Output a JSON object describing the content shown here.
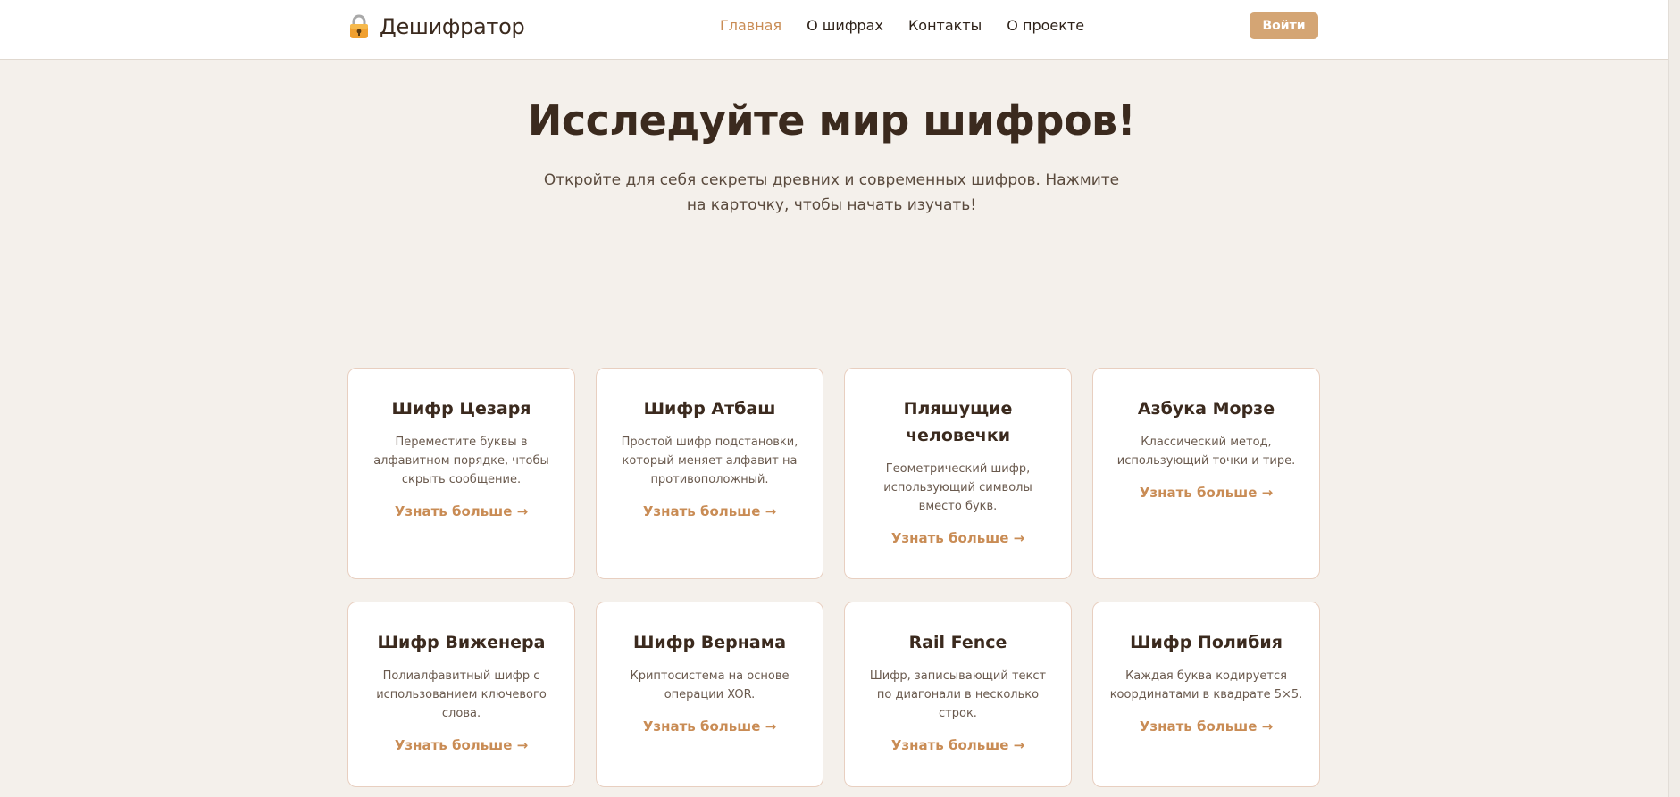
{
  "header": {
    "logo_text": "Дешифратор",
    "logo_icon": "padlock-icon",
    "nav": [
      {
        "label": "Главная",
        "active": true
      },
      {
        "label": "О шифрах",
        "active": false
      },
      {
        "label": "Контакты",
        "active": false
      },
      {
        "label": "О проекте",
        "active": false
      }
    ],
    "login_label": "Войти"
  },
  "hero": {
    "title": "Исследуйте мир шифров!",
    "subtitle": "Откройте для себя секреты древних и современных шифров. Нажмите на карточку, чтобы начать изучать!"
  },
  "cards": [
    {
      "title": "Шифр Цезаря",
      "desc": "Переместите буквы в алфавитном порядке, чтобы скрыть сообщение.",
      "link": "Узнать больше →"
    },
    {
      "title": "Шифр Атбаш",
      "desc": "Простой шифр подстановки, который меняет алфавит на противоположный.",
      "link": "Узнать больше →"
    },
    {
      "title": "Пляшущие человечки",
      "desc": "Геометрический шифр, использующий символы вместо букв.",
      "link": "Узнать больше →"
    },
    {
      "title": "Азбука Морзе",
      "desc": "Классический метод, использующий точки и тире.",
      "link": "Узнать больше →"
    },
    {
      "title": "Шифр Виженера",
      "desc": "Полиалфавитный шифр с использованием ключевого слова.",
      "link": "Узнать больше →"
    },
    {
      "title": "Шифр Вернама",
      "desc": "Криптосистема на основе операции XOR.",
      "link": "Узнать больше →"
    },
    {
      "title": "Rail Fence",
      "desc": "Шифр, записывающий текст по диагонали в несколько строк.",
      "link": "Узнать больше →"
    },
    {
      "title": "Шифр Полибия",
      "desc": "Каждая буква кодируется координатами в квадрате 5×5.",
      "link": "Узнать больше →"
    }
  ],
  "colors": {
    "accent": "#d4a574",
    "active_nav": "#c98c55",
    "background": "#f4f0eb",
    "text": "#3b2a1e"
  }
}
